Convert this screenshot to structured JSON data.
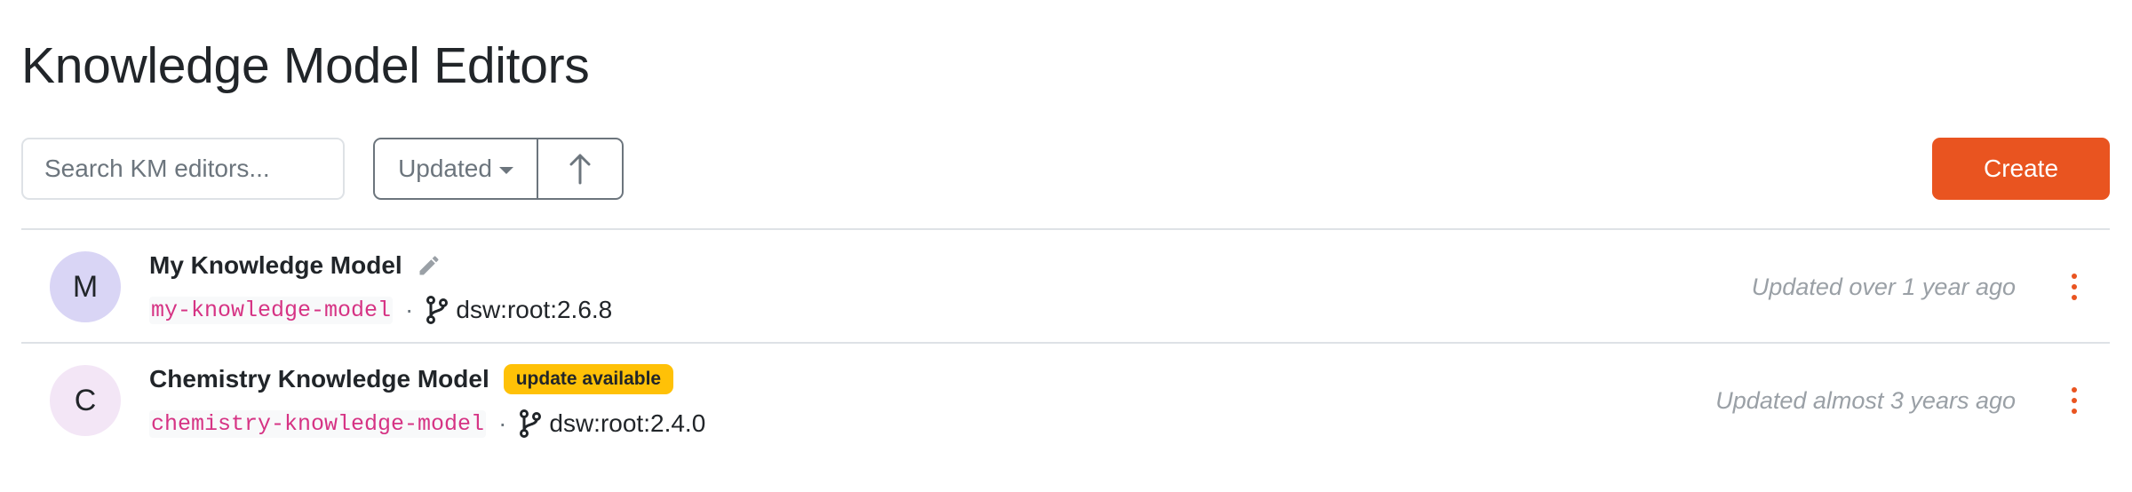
{
  "page": {
    "title": "Knowledge Model Editors"
  },
  "toolbar": {
    "search_placeholder": "Search KM editors...",
    "sort_label": "Updated",
    "sort_direction_icon": "arrow-up-icon",
    "create_label": "Create"
  },
  "colors": {
    "accent": "#e95420",
    "badge_warning": "#ffc107",
    "code_pink": "#d63384",
    "muted": "#9aa0a6"
  },
  "items": [
    {
      "initial": "M",
      "avatar_color": "#d9d5f5",
      "name": "My Knowledge Model",
      "name_icon": "pencil-icon",
      "badge": "",
      "id": "my-knowledge-model",
      "separator": "·",
      "parent": "dsw:root:2.6.8",
      "updated": "Updated over 1 year ago"
    },
    {
      "initial": "C",
      "avatar_color": "#f3e6f6",
      "name": "Chemistry Knowledge Model",
      "name_icon": "",
      "badge": "update available",
      "id": "chemistry-knowledge-model",
      "separator": "·",
      "parent": "dsw:root:2.4.0",
      "updated": "Updated almost 3 years ago"
    }
  ]
}
